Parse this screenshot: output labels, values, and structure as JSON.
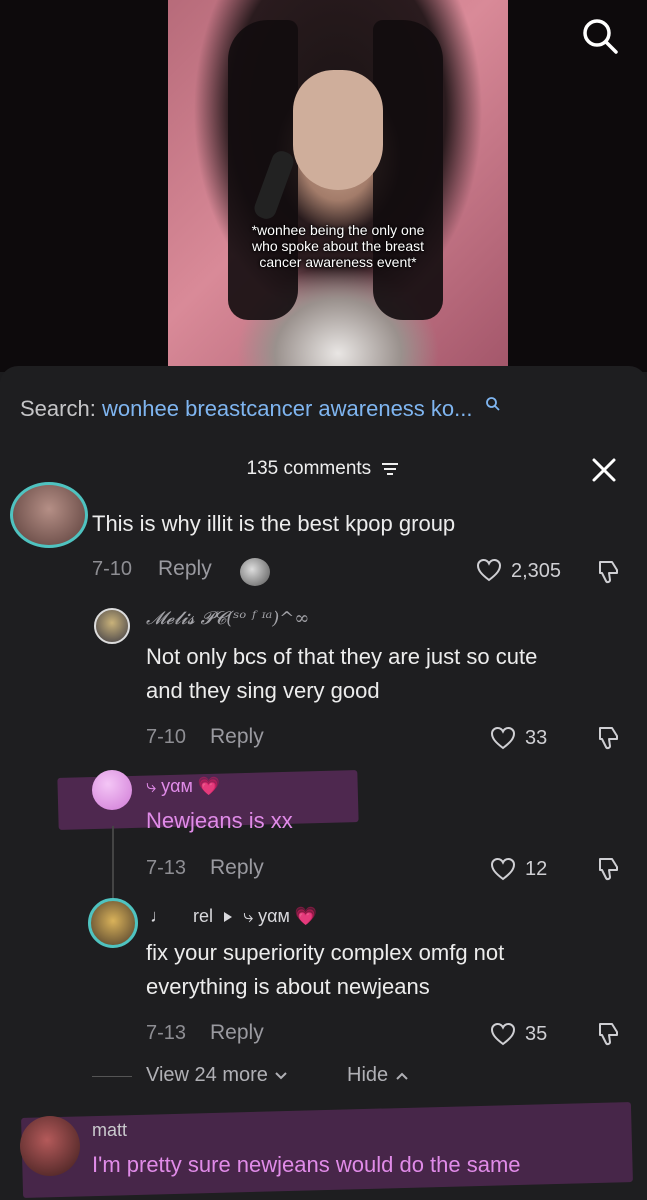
{
  "video": {
    "caption_lines": [
      "*wonhee being the only one",
      "who spoke about the breast",
      "cancer awareness event*"
    ]
  },
  "search": {
    "label": "Search:",
    "query": "wonhee breastcancer awareness ko..."
  },
  "comments_header": {
    "count_label": "135 comments"
  },
  "comments": [
    {
      "text": "This is why illit is the best kpop group",
      "date": "7-10",
      "reply_label": "Reply",
      "likes": "2,305"
    }
  ],
  "replies": [
    {
      "username": "𝓜𝓮𝓵𝓲𝓼 𝓟𝓒(ˢᵒ ᶠ ᶦᵃ)^∞",
      "text_lines": [
        "Not only bcs of that they are just so cute",
        "and they sing very good"
      ],
      "date": "7-10",
      "reply_label": "Reply",
      "likes": "33"
    },
    {
      "username": "⤷ yαм 💗",
      "text_lines": [
        "Newjeans is xx"
      ],
      "date": "7-13",
      "reply_label": "Reply",
      "likes": "12"
    },
    {
      "username_prefix": "♩",
      "username": "rel",
      "reply_to": "⤷ yαм 💗",
      "text_lines": [
        "fix your superiority complex omfg not",
        "everything is about newjeans"
      ],
      "date": "7-13",
      "reply_label": "Reply",
      "likes": "35"
    }
  ],
  "thread_controls": {
    "view_more": "View 24 more",
    "hide": "Hide"
  },
  "next_comment": {
    "username": "matt",
    "text": "I'm pretty sure newjeans would do the same"
  },
  "colors": {
    "panel_bg": "#1e1e20",
    "link_blue": "#7fb5f0",
    "highlight_pink": "#e08be8"
  },
  "icons": [
    "search-icon",
    "filter-icon",
    "close-icon",
    "heart-icon",
    "dislike-icon",
    "chevron-down-icon",
    "chevron-up-icon",
    "play-triangle-icon"
  ]
}
